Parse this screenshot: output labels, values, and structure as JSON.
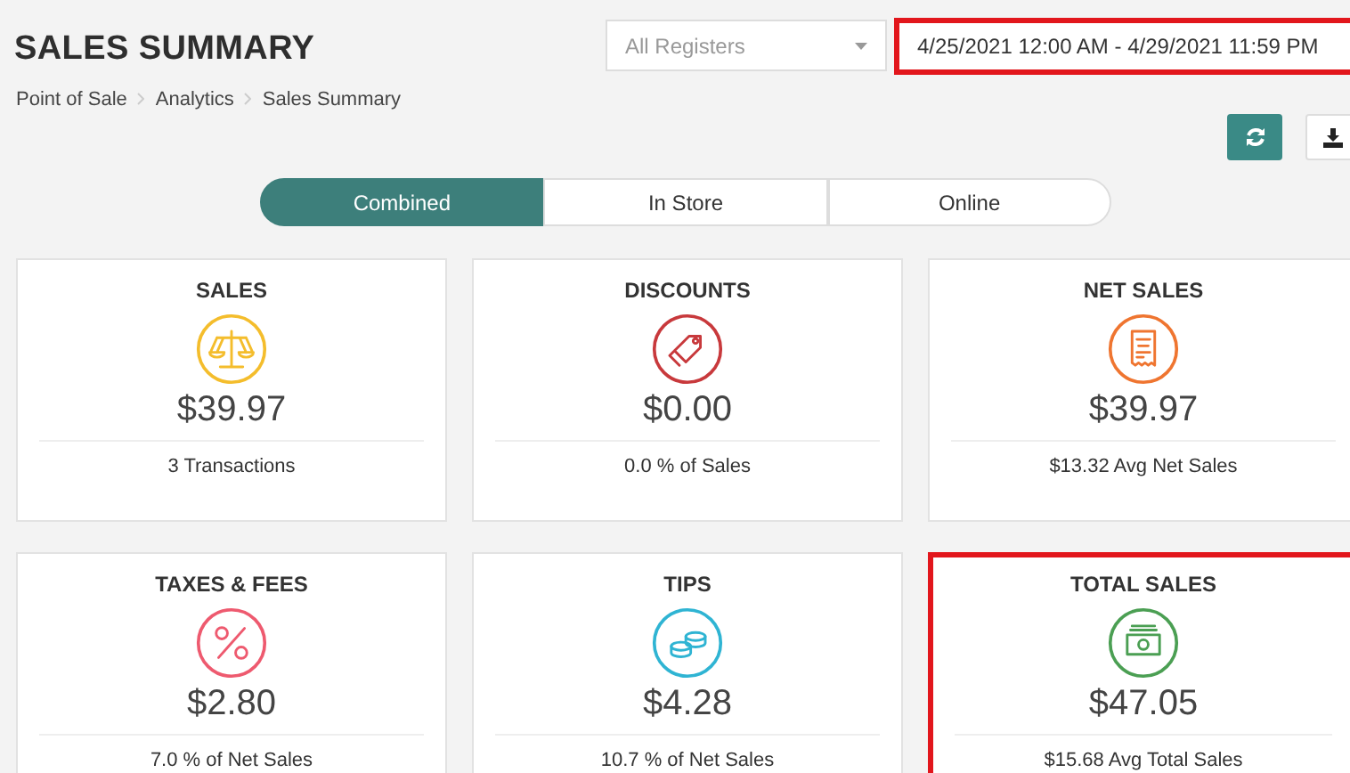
{
  "header": {
    "title": "SALES SUMMARY",
    "breadcrumbs": [
      "Point of Sale",
      "Analytics",
      "Sales Summary"
    ]
  },
  "register_select": {
    "value": "All Registers"
  },
  "date_range": {
    "value": "4/25/2021 12:00 AM - 4/29/2021 11:59 PM",
    "highlighted": true
  },
  "tabs": [
    {
      "label": "Combined",
      "selected": true
    },
    {
      "label": "In Store",
      "selected": false
    },
    {
      "label": "Online",
      "selected": false
    }
  ],
  "cards": [
    {
      "title": "SALES",
      "kind": "scale",
      "color": "#f4bd2c",
      "value": "$39.97",
      "note": "3 Transactions",
      "highlighted": false
    },
    {
      "title": "DISCOUNTS",
      "kind": "tag",
      "color": "#c8393c",
      "value": "$0.00",
      "note": "0.0 % of Sales",
      "highlighted": false
    },
    {
      "title": "NET SALES",
      "kind": "receipt",
      "color": "#ef7530",
      "value": "$39.97",
      "note": "$13.32 Avg Net Sales",
      "highlighted": false
    },
    {
      "title": "TAXES & FEES",
      "kind": "percent",
      "color": "#ee5a6f",
      "value": "$2.80",
      "note": "7.0 % of Net Sales",
      "highlighted": false
    },
    {
      "title": "TIPS",
      "kind": "coins",
      "color": "#2fb4d3",
      "value": "$4.28",
      "note": "10.7 % of Net Sales",
      "highlighted": false
    },
    {
      "title": "TOTAL SALES",
      "kind": "cash",
      "color": "#4b9f53",
      "value": "$47.05",
      "note": "$15.68 Avg Total Sales",
      "highlighted": true
    }
  ]
}
